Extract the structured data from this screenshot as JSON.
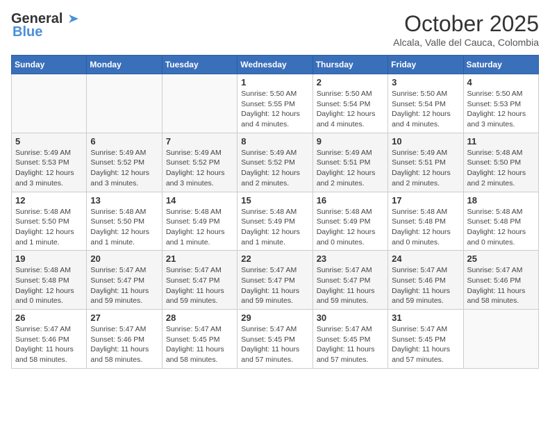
{
  "header": {
    "logo_general": "General",
    "logo_blue": "Blue",
    "month_title": "October 2025",
    "location": "Alcala, Valle del Cauca, Colombia"
  },
  "weekdays": [
    "Sunday",
    "Monday",
    "Tuesday",
    "Wednesday",
    "Thursday",
    "Friday",
    "Saturday"
  ],
  "weeks": [
    [
      {
        "day": "",
        "info": ""
      },
      {
        "day": "",
        "info": ""
      },
      {
        "day": "",
        "info": ""
      },
      {
        "day": "1",
        "info": "Sunrise: 5:50 AM\nSunset: 5:55 PM\nDaylight: 12 hours\nand 4 minutes."
      },
      {
        "day": "2",
        "info": "Sunrise: 5:50 AM\nSunset: 5:54 PM\nDaylight: 12 hours\nand 4 minutes."
      },
      {
        "day": "3",
        "info": "Sunrise: 5:50 AM\nSunset: 5:54 PM\nDaylight: 12 hours\nand 4 minutes."
      },
      {
        "day": "4",
        "info": "Sunrise: 5:50 AM\nSunset: 5:53 PM\nDaylight: 12 hours\nand 3 minutes."
      }
    ],
    [
      {
        "day": "5",
        "info": "Sunrise: 5:49 AM\nSunset: 5:53 PM\nDaylight: 12 hours\nand 3 minutes."
      },
      {
        "day": "6",
        "info": "Sunrise: 5:49 AM\nSunset: 5:52 PM\nDaylight: 12 hours\nand 3 minutes."
      },
      {
        "day": "7",
        "info": "Sunrise: 5:49 AM\nSunset: 5:52 PM\nDaylight: 12 hours\nand 3 minutes."
      },
      {
        "day": "8",
        "info": "Sunrise: 5:49 AM\nSunset: 5:52 PM\nDaylight: 12 hours\nand 2 minutes."
      },
      {
        "day": "9",
        "info": "Sunrise: 5:49 AM\nSunset: 5:51 PM\nDaylight: 12 hours\nand 2 minutes."
      },
      {
        "day": "10",
        "info": "Sunrise: 5:49 AM\nSunset: 5:51 PM\nDaylight: 12 hours\nand 2 minutes."
      },
      {
        "day": "11",
        "info": "Sunrise: 5:48 AM\nSunset: 5:50 PM\nDaylight: 12 hours\nand 2 minutes."
      }
    ],
    [
      {
        "day": "12",
        "info": "Sunrise: 5:48 AM\nSunset: 5:50 PM\nDaylight: 12 hours\nand 1 minute."
      },
      {
        "day": "13",
        "info": "Sunrise: 5:48 AM\nSunset: 5:50 PM\nDaylight: 12 hours\nand 1 minute."
      },
      {
        "day": "14",
        "info": "Sunrise: 5:48 AM\nSunset: 5:49 PM\nDaylight: 12 hours\nand 1 minute."
      },
      {
        "day": "15",
        "info": "Sunrise: 5:48 AM\nSunset: 5:49 PM\nDaylight: 12 hours\nand 1 minute."
      },
      {
        "day": "16",
        "info": "Sunrise: 5:48 AM\nSunset: 5:49 PM\nDaylight: 12 hours\nand 0 minutes."
      },
      {
        "day": "17",
        "info": "Sunrise: 5:48 AM\nSunset: 5:48 PM\nDaylight: 12 hours\nand 0 minutes."
      },
      {
        "day": "18",
        "info": "Sunrise: 5:48 AM\nSunset: 5:48 PM\nDaylight: 12 hours\nand 0 minutes."
      }
    ],
    [
      {
        "day": "19",
        "info": "Sunrise: 5:48 AM\nSunset: 5:48 PM\nDaylight: 12 hours\nand 0 minutes."
      },
      {
        "day": "20",
        "info": "Sunrise: 5:47 AM\nSunset: 5:47 PM\nDaylight: 11 hours\nand 59 minutes."
      },
      {
        "day": "21",
        "info": "Sunrise: 5:47 AM\nSunset: 5:47 PM\nDaylight: 11 hours\nand 59 minutes."
      },
      {
        "day": "22",
        "info": "Sunrise: 5:47 AM\nSunset: 5:47 PM\nDaylight: 11 hours\nand 59 minutes."
      },
      {
        "day": "23",
        "info": "Sunrise: 5:47 AM\nSunset: 5:47 PM\nDaylight: 11 hours\nand 59 minutes."
      },
      {
        "day": "24",
        "info": "Sunrise: 5:47 AM\nSunset: 5:46 PM\nDaylight: 11 hours\nand 59 minutes."
      },
      {
        "day": "25",
        "info": "Sunrise: 5:47 AM\nSunset: 5:46 PM\nDaylight: 11 hours\nand 58 minutes."
      }
    ],
    [
      {
        "day": "26",
        "info": "Sunrise: 5:47 AM\nSunset: 5:46 PM\nDaylight: 11 hours\nand 58 minutes."
      },
      {
        "day": "27",
        "info": "Sunrise: 5:47 AM\nSunset: 5:46 PM\nDaylight: 11 hours\nand 58 minutes."
      },
      {
        "day": "28",
        "info": "Sunrise: 5:47 AM\nSunset: 5:45 PM\nDaylight: 11 hours\nand 58 minutes."
      },
      {
        "day": "29",
        "info": "Sunrise: 5:47 AM\nSunset: 5:45 PM\nDaylight: 11 hours\nand 57 minutes."
      },
      {
        "day": "30",
        "info": "Sunrise: 5:47 AM\nSunset: 5:45 PM\nDaylight: 11 hours\nand 57 minutes."
      },
      {
        "day": "31",
        "info": "Sunrise: 5:47 AM\nSunset: 5:45 PM\nDaylight: 11 hours\nand 57 minutes."
      },
      {
        "day": "",
        "info": ""
      }
    ]
  ]
}
